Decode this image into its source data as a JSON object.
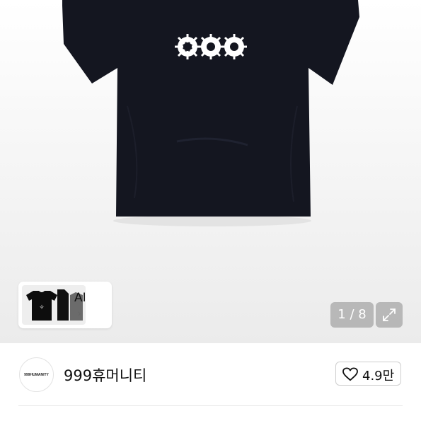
{
  "product": {
    "image_icon": "tshirt-image",
    "ai_thumbnail": {
      "label": "AI",
      "chevron_icon": "chevron-right-icon"
    },
    "pager": {
      "text": "1 / 8",
      "current": 1,
      "total": 8
    },
    "expand_icon": "expand-arrows-icon"
  },
  "shop": {
    "avatar_text": "999HUMANITY",
    "name": "999휴머니티",
    "like_icon": "heart-icon",
    "like_count": "4.9만"
  },
  "colors": {
    "shirt": "#141620",
    "print": "#ffffff",
    "badge_bg": "#8a8a8a"
  }
}
